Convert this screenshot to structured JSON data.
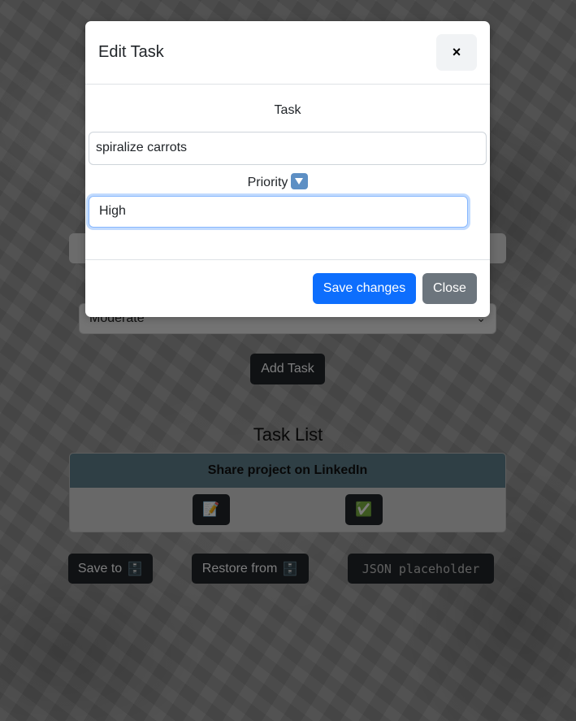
{
  "page": {
    "priority_select_value": "Moderate",
    "add_task_label": "Add Task",
    "task_list_title": "Task List",
    "task_card": {
      "title": "Share project on LinkedIn",
      "edit_icon": "memo-icon",
      "done_icon": "check-mark-button-icon"
    },
    "save_to_label": "Save to",
    "restore_from_label": "Restore from",
    "storage_icon": "file-cabinet-icon",
    "json_placeholder_label": "JSON placeholder"
  },
  "modal": {
    "title": "Edit Task",
    "close_symbol": "×",
    "task_label": "Task",
    "task_value": "spiralize carrots",
    "priority_label": "Priority",
    "priority_icon": "down-arrow-button-icon",
    "priority_value": "High",
    "save_label": "Save changes",
    "close_label": "Close"
  },
  "colors": {
    "primary": "#0d6efd",
    "secondary": "#6c757d",
    "dark": "#212529",
    "card_header": "#5f7f8b"
  }
}
